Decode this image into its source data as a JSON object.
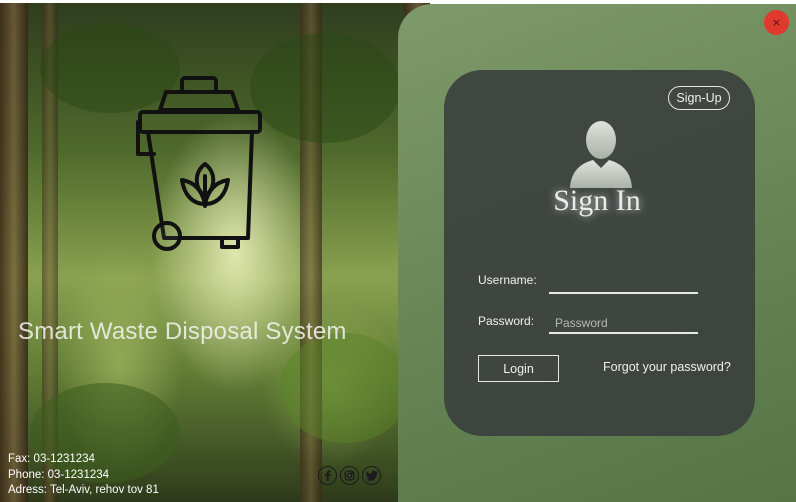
{
  "app": {
    "title": "Smart Waste Disposal System",
    "close_symbol": "×"
  },
  "colors": {
    "panel_green": "#6c8a5a",
    "card_bg": "#3c403e",
    "close_red": "#e03a2e",
    "text_light": "#f0f0f0"
  },
  "branding": {
    "logo_icon": "recycle-bin-leaf-icon"
  },
  "contact": {
    "fax": "Fax: 03-1231234",
    "phone": "Phone: 03-1231234",
    "address": "Adress: Tel-Aviv, rehov tov 81"
  },
  "socials": [
    {
      "name": "facebook-icon"
    },
    {
      "name": "instagram-icon"
    },
    {
      "name": "twitter-icon"
    }
  ],
  "login": {
    "signup_label": "Sign-Up",
    "avatar_icon": "user-avatar-icon",
    "heading": "Sign In",
    "username_label": "Username:",
    "username_value": "",
    "password_label": "Password:",
    "password_placeholder": "Password",
    "login_button": "Login",
    "forgot_link": "Forgot your password?"
  }
}
